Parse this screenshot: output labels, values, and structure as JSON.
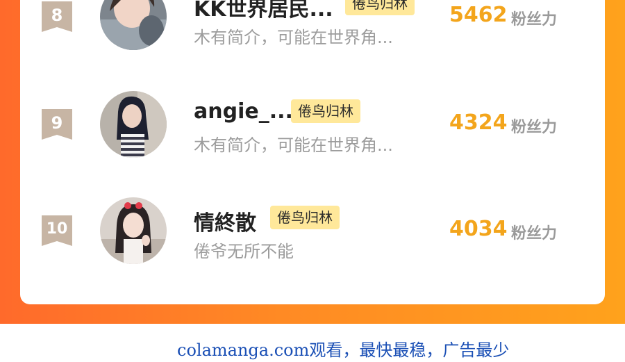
{
  "colors": {
    "frame_gradient_start": "#ff6a2b",
    "frame_gradient_end": "#ffa21c",
    "rank_badge": "#c7b5a4",
    "tag_background": "#ffe89a",
    "score": "#f3a51c",
    "watermark": "#1a4fb5"
  },
  "ranking": [
    {
      "rank": "8",
      "name": "KK世界居民...",
      "tag": "倦鸟归林",
      "bio": "木有简介，可能在世界角...",
      "score": "5462",
      "unit": "粉丝力"
    },
    {
      "rank": "9",
      "name": "angie_...",
      "tag": "倦鸟归林",
      "bio": "木有简介，可能在世界角...",
      "score": "4324",
      "unit": "粉丝力"
    },
    {
      "rank": "10",
      "name": "情終散",
      "tag": "倦鸟归林",
      "bio": "倦爷无所不能",
      "score": "4034",
      "unit": "粉丝力"
    }
  ],
  "footer": {
    "watermark": "colamanga.com观看，最快最稳，广告最少"
  }
}
